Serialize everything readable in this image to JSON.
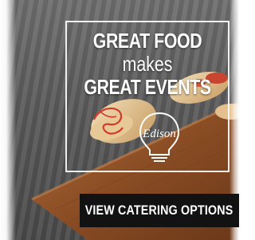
{
  "ad": {
    "headline_line1": "GREAT FOOD",
    "headline_line2": "makes",
    "headline_line3": "GREAT EVENTS",
    "logo_text": "Edison",
    "cta_label": "VIEW CATERING OPTIONS"
  }
}
